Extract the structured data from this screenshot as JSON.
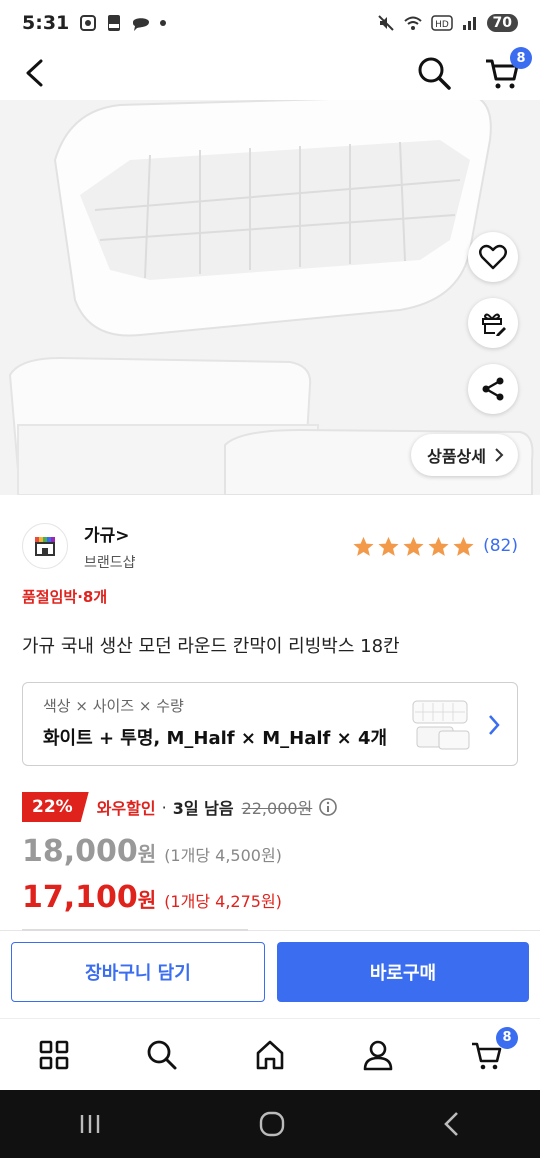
{
  "status": {
    "time": "5:31",
    "battery": "70"
  },
  "header": {
    "cart_count": "8"
  },
  "hero": {
    "detail_label": "상품상세",
    "dot_count": 9,
    "active_dot": 0
  },
  "brand": {
    "name": "가규>",
    "sub": "브랜드샵",
    "rating_stars": 5,
    "review_count": "(82)"
  },
  "product": {
    "stock_notice": "품절임박·8개",
    "title": "가규 국내 생산 모던 라운드 칸막이 리빙박스 18칸"
  },
  "option": {
    "label": "색상 × 사이즈 × 수량",
    "value": "화이트 + 투명, M_Half × M_Half × 4개"
  },
  "discount": {
    "rate": "22%",
    "name": "와우할인",
    "separator": "·",
    "days_left": "3일 남음",
    "original_price": "22,000원"
  },
  "price_regular": {
    "amount": "18,000",
    "won": "원",
    "unit": "(1개당 4,500원)"
  },
  "price_wow": {
    "amount": "17,100",
    "won": "원",
    "unit": "(1개당 4,275원)"
  },
  "cta": {
    "cart_label": "장바구니 담기",
    "buy_label": "바로구매"
  },
  "bottom_nav": {
    "cart_count": "8"
  },
  "colors": {
    "accent": "#3a6df0",
    "sale": "#e0221c",
    "star": "#f2994a"
  }
}
